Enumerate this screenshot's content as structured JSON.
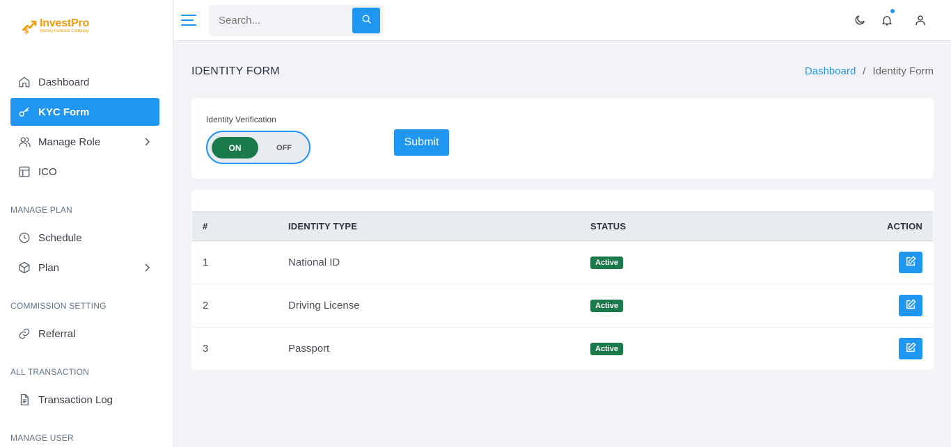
{
  "brand": {
    "name": "InvestPro",
    "tagline": "Money Increase Company",
    "color": "#f29b0a"
  },
  "colors": {
    "primary": "#1f96ef",
    "success": "#1b7a4a"
  },
  "sidebar": {
    "items": [
      {
        "label": "Dashboard",
        "icon": "home-icon"
      },
      {
        "label": "KYC Form",
        "icon": "key-icon",
        "active": true
      },
      {
        "label": "Manage Role",
        "icon": "users-icon",
        "expandable": true
      },
      {
        "label": "ICO",
        "icon": "layout-icon"
      }
    ],
    "sections": [
      {
        "title": "MANAGE PLAN",
        "items": [
          {
            "label": "Schedule",
            "icon": "clock-icon"
          },
          {
            "label": "Plan",
            "icon": "box-icon",
            "expandable": true
          }
        ]
      },
      {
        "title": "COMMISSION SETTING",
        "items": [
          {
            "label": "Referral",
            "icon": "link-icon"
          }
        ]
      },
      {
        "title": "ALL TRANSACTION",
        "items": [
          {
            "label": "Transaction Log",
            "icon": "file-text-icon"
          }
        ]
      },
      {
        "title": "MANAGE USER",
        "items": []
      }
    ]
  },
  "topbar": {
    "search": {
      "placeholder": "Search...",
      "value": ""
    },
    "icons": [
      "menu-icon",
      "search-icon",
      "moon-icon",
      "bell-icon",
      "user-icon"
    ]
  },
  "page": {
    "title": "IDENTITY FORM",
    "breadcrumb": {
      "home": "Dashboard",
      "separator": "/",
      "current": "Identity Form"
    }
  },
  "form": {
    "label": "Identity Verification",
    "toggle": {
      "on_label": "ON",
      "off_label": "OFF",
      "state": "on"
    },
    "submit_label": "Submit"
  },
  "table": {
    "headers": [
      "#",
      "IDENTITY TYPE",
      "STATUS",
      "ACTION"
    ],
    "rows": [
      {
        "num": "1",
        "type": "National ID",
        "status": "Active"
      },
      {
        "num": "2",
        "type": "Driving License",
        "status": "Active"
      },
      {
        "num": "3",
        "type": "Passport",
        "status": "Active"
      }
    ]
  }
}
